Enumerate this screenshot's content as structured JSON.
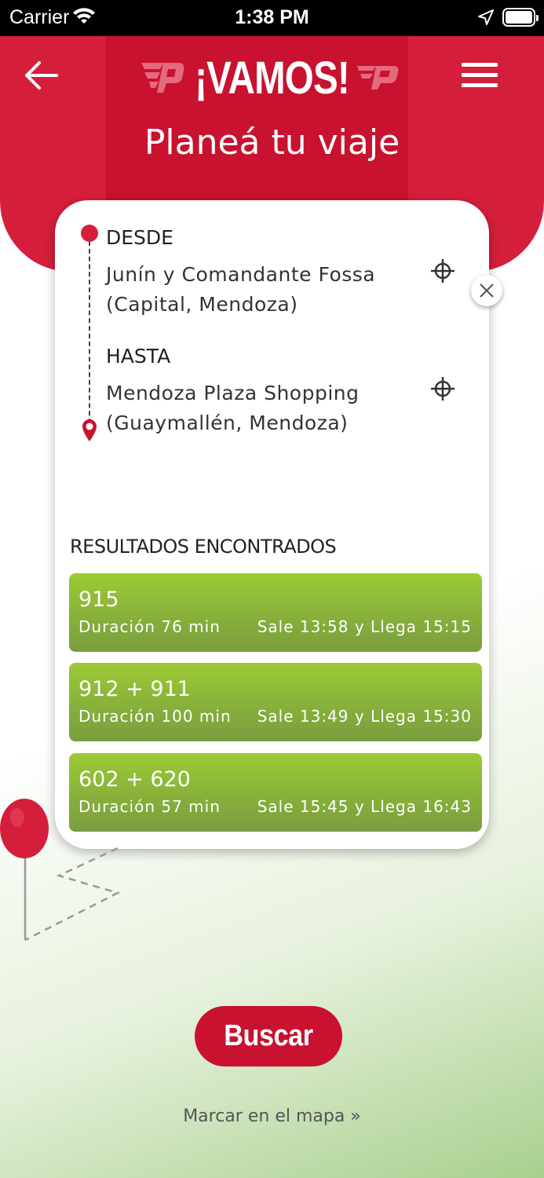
{
  "status_bar": {
    "carrier": "Carrier",
    "time": "1:38 PM",
    "icons": [
      "wifi-icon",
      "location-arrow-icon",
      "battery-icon"
    ]
  },
  "header": {
    "brand": "¡VAMOS!",
    "title": "Planeá tu viaje",
    "icons": [
      "back-arrow-icon",
      "hamburger-menu-icon"
    ],
    "color": "#d51e3c"
  },
  "trip": {
    "from_label": "DESDE",
    "from_address_line1": "Junín y Comandante Fossa",
    "from_address_line2": "(Capital, Mendoza)",
    "to_label": "HASTA",
    "to_address_line1": "Mendoza Plaza Shopping",
    "to_address_line2": "(Guaymallén, Mendoza)"
  },
  "results": {
    "heading": "RESULTADOS ENCONTRADOS",
    "items": [
      {
        "route": "915",
        "duration": "Duración 76 min",
        "times": "Sale 13:58 y Llega 15:15"
      },
      {
        "route": "912 + 911",
        "duration": "Duración 100 min",
        "times": "Sale 13:49 y Llega 15:30"
      },
      {
        "route": "602 + 620",
        "duration": "Duración 57 min",
        "times": "Sale 15:45 y Llega 16:43"
      }
    ],
    "color": "#8fbc3a"
  },
  "actions": {
    "search_label": "Buscar",
    "map_link": "Marcar en el mapa »"
  }
}
